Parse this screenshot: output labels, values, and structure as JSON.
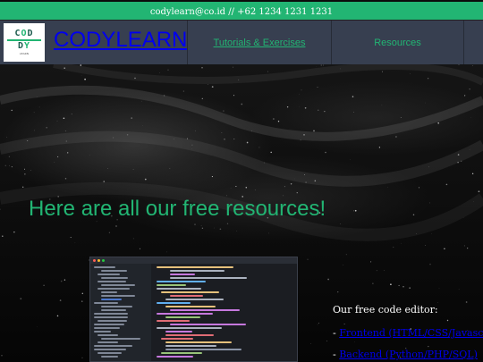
{
  "topbar": {
    "contact": "codylearn@co.id // +62 1234 1231 1231"
  },
  "brand": {
    "logo_top": "C O D",
    "logo_bottom": "D Y",
    "logo_tagline": "LEARN",
    "name": "CODYLEARN"
  },
  "nav": {
    "items": [
      {
        "label": "Tutorials & Exercises"
      },
      {
        "label": "Resources"
      }
    ]
  },
  "hero": {
    "title": "Here are all our free resources!"
  },
  "editor_section": {
    "heading": "Our free code editor:",
    "links": [
      {
        "prefix": "- ",
        "label": "Frontend (HTML/CSS/Javascript)"
      },
      {
        "prefix": "- ",
        "label": "Backend (Python/PHP/SQL)"
      }
    ]
  },
  "colors": {
    "accent": "#22b573",
    "nav_bg": "#373f50",
    "link": "#0000ee"
  }
}
